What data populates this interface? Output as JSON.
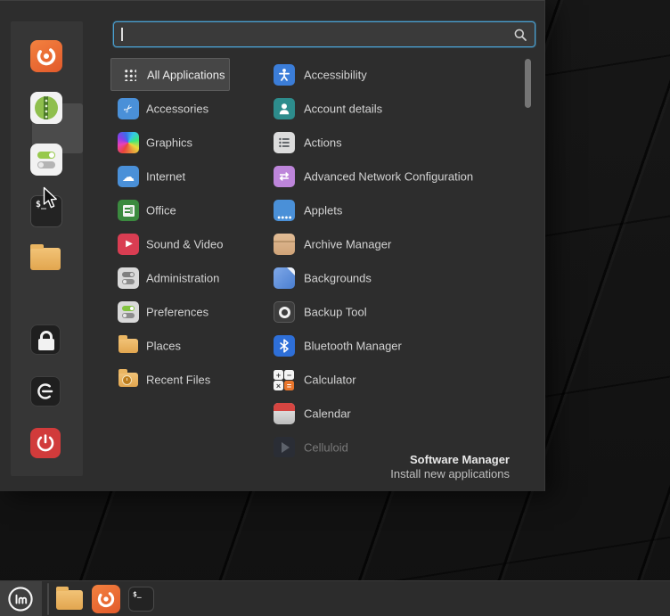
{
  "menu": {
    "search": {
      "value": "",
      "placeholder": ""
    },
    "categories": [
      {
        "label": "All Applications",
        "selected": true
      },
      {
        "label": "Accessories"
      },
      {
        "label": "Graphics"
      },
      {
        "label": "Internet"
      },
      {
        "label": "Office"
      },
      {
        "label": "Sound & Video"
      },
      {
        "label": "Administration"
      },
      {
        "label": "Preferences"
      },
      {
        "label": "Places"
      },
      {
        "label": "Recent Files"
      }
    ],
    "applications": [
      "Accessibility",
      "Account details",
      "Actions",
      "Advanced Network Configuration",
      "Applets",
      "Archive Manager",
      "Backgrounds",
      "Backup Tool",
      "Bluetooth Manager",
      "Calculator",
      "Calendar",
      "Celluloid"
    ],
    "favorites": [
      "Firefox",
      "Software Manager",
      "System Settings",
      "Terminal",
      "Files"
    ],
    "session_buttons": [
      "Lock Screen",
      "Logout",
      "Quit"
    ],
    "info": {
      "title": "Software Manager",
      "subtitle": "Install new applications"
    }
  },
  "taskbar": {
    "items": [
      "Menu",
      "Files",
      "Firefox",
      "Terminal"
    ]
  },
  "icons": {
    "terminal_glyph": "$_",
    "accessories_glyph": "✂",
    "internet_glyph": "☁",
    "sound_video_glyph": "▶",
    "network_glyph": "⇄",
    "calc": {
      "plus": "+",
      "minus": "−",
      "times": "×",
      "equals": "="
    }
  },
  "colors": {
    "menu_bg": "#2d2d2d",
    "search_border": "#4aa1d2",
    "selected_bg": "#464646",
    "hover_bg": "#4b4b4b",
    "text": "#d2d2d2",
    "taskbar_bg": "#2c2c2c",
    "firefox_orange": "#e8663a",
    "power_red": "#d13b3b",
    "mint_green": "#8fbf4d"
  }
}
